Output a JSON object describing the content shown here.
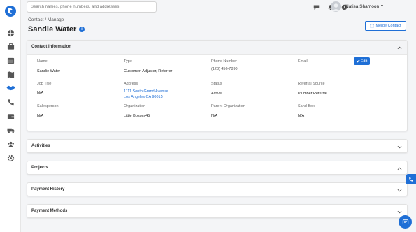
{
  "search": {
    "placeholder": "Search names, phone numbers, and addresses"
  },
  "user": {
    "name": "Nafisa Shamoon"
  },
  "header": {
    "breadcrumb": "Contact / Manage",
    "title": "Sandie Water",
    "merge_label": "Merge Contact"
  },
  "contact_info": {
    "title": "Contact Information",
    "edit_label": "Edit",
    "fields": {
      "name_label": "Name",
      "name_value": "Sandie Water",
      "type_label": "Type",
      "type_value": "Customer, Adjuster, Referrer",
      "phone_label": "Phone Number",
      "phone_value": "(123) 456-7890",
      "email_label": "Email",
      "job_label": "Job Title",
      "job_value": "N/A",
      "address_label": "Address",
      "address_line1": "1111 South Grand Avenue",
      "address_line2": "Los Angeles CA 90015",
      "status_label": "Status",
      "status_value": "Active",
      "referral_label": "Referral Source",
      "referral_value": "Plumber Referral",
      "sales_label": "Salesperson",
      "sales_value": "N/A",
      "org_label": "Organization",
      "org_value": "Little Bosses45",
      "parent_label": "Parent Organization",
      "parent_value": "N/A",
      "sandbox_label": "Sand Box",
      "sandbox_value": "N/A"
    }
  },
  "sections": {
    "activities": "Activities",
    "projects": "Projects",
    "payment_history": "Payment History",
    "payment_methods": "Payment Methods"
  },
  "colors": {
    "accent": "#1f6fd6",
    "background": "#f4f5f7"
  }
}
